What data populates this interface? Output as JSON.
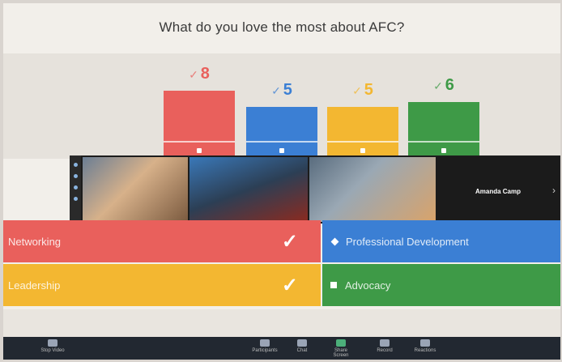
{
  "poll": {
    "question": "What do you love the most about AFC?",
    "options": [
      {
        "label": "Networking",
        "count": "8",
        "share": 0.333,
        "color": "#e9605c",
        "selected": true
      },
      {
        "label": "Professional Development",
        "count": "5",
        "share": 0.208,
        "color": "#3b7fd4",
        "selected": false
      },
      {
        "label": "Leadership",
        "count": "5",
        "share": 0.208,
        "color": "#f3b731",
        "selected": true
      },
      {
        "label": "Advocacy",
        "count": "6",
        "share": 0.25,
        "color": "#3e9a47",
        "selected": false
      }
    ]
  },
  "video": {
    "participants": [
      "",
      "",
      "",
      "Amanda Camp"
    ]
  },
  "taskbar": {
    "left_text": "",
    "mid_text": ""
  },
  "toolbar": {
    "buttons": [
      "Stop Video",
      "Participants",
      "Chat",
      "Share Screen",
      "Record",
      "Reactions"
    ]
  },
  "icons": {
    "check": "check-icon",
    "square": "square-icon",
    "diamond": "diamond-icon",
    "arrow": "chevron-right-icon"
  }
}
